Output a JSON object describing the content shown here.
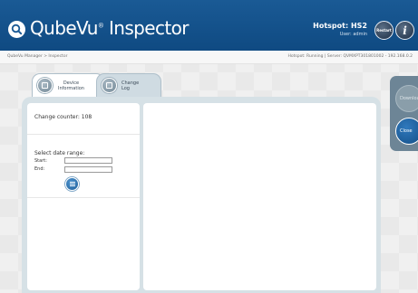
{
  "header": {
    "app_name": "QubeVu",
    "app_trademark": "®",
    "app_suffix": " Inspector",
    "hotspot_title": "Hotspot: HS2",
    "user_label": "User: admin",
    "restart_label": "Restart",
    "info_label": "i"
  },
  "breadcrumb": "QubeVu Manager > Inspector",
  "status": "Hotspot: Running | Server: QVMXPT301801002 - 192.168.0.2",
  "tabs": [
    {
      "label": "Device\nInformation"
    },
    {
      "label": "Change\nLog"
    }
  ],
  "change_log": {
    "counter_text": "Change counter: 108",
    "date_range_heading": "Select date range:",
    "start_label": "Start:",
    "start_value": "",
    "end_label": "End:",
    "end_value": ""
  },
  "actions": {
    "download_label": "Download",
    "close_label": "Close"
  },
  "colors": {
    "header": "#1a5a95",
    "panel": "#d6e1e6",
    "accent_button": "#1f5f99",
    "side_panel": "#6d8596"
  }
}
